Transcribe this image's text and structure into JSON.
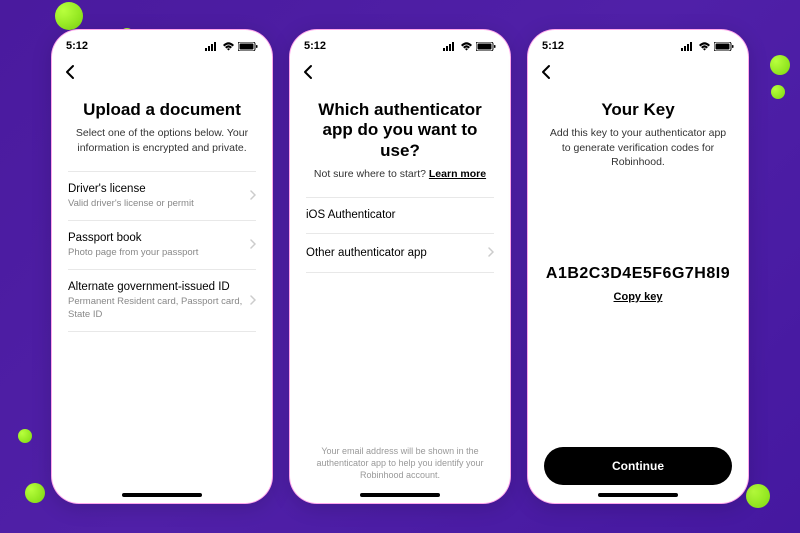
{
  "statusbar": {
    "time": "5:12"
  },
  "screen1": {
    "title": "Upload a document",
    "subtitle": "Select one of the options below. Your information is encrypted and private.",
    "options": [
      {
        "label": "Driver's license",
        "desc": "Valid driver's license or permit"
      },
      {
        "label": "Passport book",
        "desc": "Photo page from your passport"
      },
      {
        "label": "Alternate government-issued ID",
        "desc": "Permanent Resident card, Passport card, State ID"
      }
    ]
  },
  "screen2": {
    "title": "Which authenticator app do you want to use?",
    "subtitle_prefix": "Not sure where to start? ",
    "subtitle_link": "Learn more",
    "options": [
      {
        "label": "iOS Authenticator"
      },
      {
        "label": "Other authenticator app"
      }
    ],
    "footer": "Your email address will be shown in the authenticator app to help you identify your Robinhood account."
  },
  "screen3": {
    "title": "Your Key",
    "subtitle": "Add this key to your authenticator app to generate verification codes for Robinhood.",
    "key": "A1B2C3D4E5F6G7H8I9",
    "copy_label": "Copy key",
    "continue_label": "Continue"
  }
}
